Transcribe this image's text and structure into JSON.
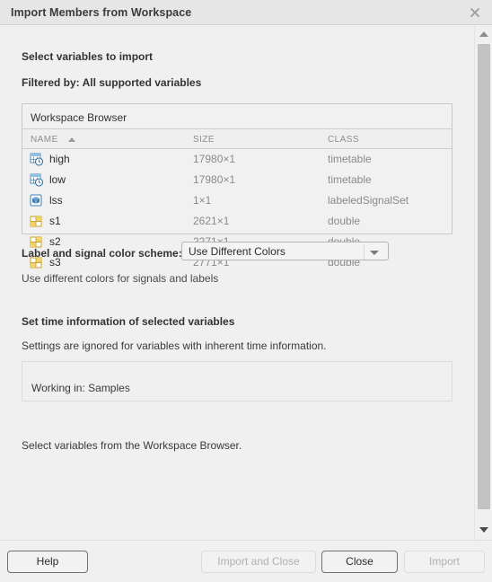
{
  "window": {
    "title": "Import Members from Workspace",
    "close_icon": "close-icon"
  },
  "body": {
    "select_variables_label": "Select variables to import",
    "filtered_by_label": "Filtered by: All supported variables",
    "color_scheme_label": "Label and signal color scheme:",
    "color_scheme_value": "Use Different Colors",
    "color_scheme_hint": "Use different colors for signals and labels",
    "set_time_heading": "Set time information of selected variables",
    "set_time_hint": "Settings are ignored for variables with inherent time information.",
    "working_in_text": "Working in:  Samples",
    "status_text": "Select variables from the Workspace Browser."
  },
  "table": {
    "caption": "Workspace Browser",
    "columns": [
      "NAME",
      "SIZE",
      "CLASS"
    ],
    "sort_column": "NAME",
    "sort_direction": "ascending",
    "rows": [
      {
        "name": "high",
        "size": "17980×1",
        "class": "timetable",
        "icon": "timetable-icon"
      },
      {
        "name": "low",
        "size": "17980×1",
        "class": "timetable",
        "icon": "timetable-icon"
      },
      {
        "name": "lss",
        "size": "1×1",
        "class": "labeledSignalSet",
        "icon": "labeled-signal-set-icon"
      },
      {
        "name": "s1",
        "size": "2621×1",
        "class": "double",
        "icon": "matrix-icon"
      },
      {
        "name": "s2",
        "size": "2271×1",
        "class": "double",
        "icon": "matrix-icon"
      },
      {
        "name": "s3",
        "size": "2771×1",
        "class": "double",
        "icon": "matrix-icon"
      }
    ]
  },
  "footer": {
    "help": "Help",
    "import_and_close": "Import and Close",
    "close": "Close",
    "import": "Import"
  },
  "scrollbar": {
    "up_icon": "scroll-up-arrow-icon",
    "down_icon": "scroll-down-arrow-icon"
  },
  "colors": {
    "window_bg": "#f0f0f0",
    "titlebar_bg": "#e6e6e6",
    "muted_text": "#8a8a8a",
    "icon_blue": "#4a90c4",
    "icon_yellow": "#f2d26b"
  }
}
